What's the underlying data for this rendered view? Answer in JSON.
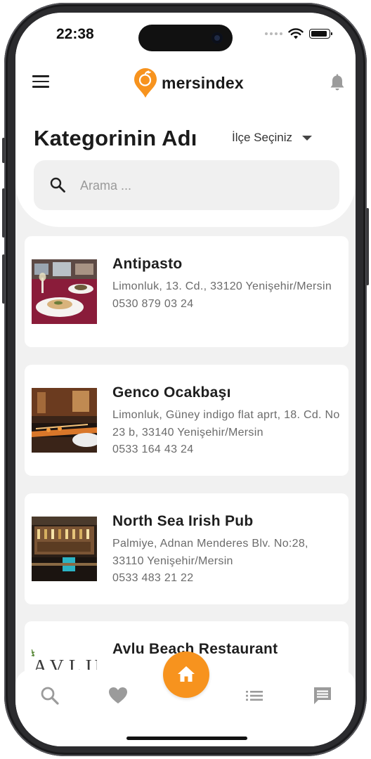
{
  "status": {
    "time": "22:38"
  },
  "app": {
    "logo_text": "mersindex",
    "brand_color": "#f7931e"
  },
  "page": {
    "title": "Kategorinin Adı",
    "district_label": "İlçe Seçiniz"
  },
  "search": {
    "placeholder": "Arama ..."
  },
  "listings": [
    {
      "name": "Antipasto",
      "address": "Limonluk, 13. Cd., 33120 Yenişehir/Mersin",
      "phone": "0530 879 03 24"
    },
    {
      "name": "Genco Ocakbaşı",
      "address": "Limonluk, Güney indigo flat aprt, 18. Cd. No 23 b, 33140 Yenişehir/Mersin",
      "phone": "0533 164 43 24"
    },
    {
      "name": "North Sea Irish Pub",
      "address": "Palmiye, Adnan Menderes Blv. No:28, 33110 Yenişehir/Mersin",
      "phone": "0533 483 21 22"
    },
    {
      "name": "Avlu Beach Restaurant",
      "logo_text": "AVLU"
    }
  ],
  "bottom_nav": {
    "items": [
      {
        "icon": "search-icon"
      },
      {
        "icon": "heart-icon"
      },
      {
        "icon": "home-icon"
      },
      {
        "icon": "list-icon"
      },
      {
        "icon": "chat-icon"
      }
    ]
  }
}
